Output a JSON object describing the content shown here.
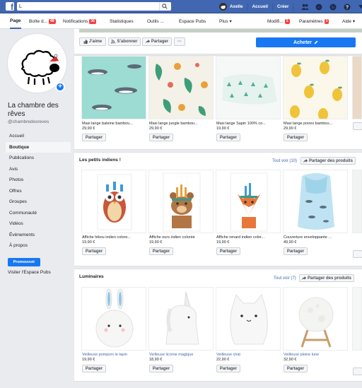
{
  "topbar": {
    "search_value": "L",
    "user_name": "Axelle",
    "home": "Accueil",
    "create": "Créer"
  },
  "pagenav": {
    "tabs": [
      {
        "label": "Page",
        "badge": ""
      },
      {
        "label": "Boîte d...",
        "badge": "48"
      },
      {
        "label": "Notifications",
        "badge": "36"
      },
      {
        "label": "Statistiques",
        "badge": ""
      },
      {
        "label": "Outils ...",
        "badge": ""
      },
      {
        "label": "Espace Pubs",
        "badge": ""
      },
      {
        "label": "Plus ▾",
        "badge": ""
      },
      {
        "label": "Modifi...",
        "badge": "3"
      },
      {
        "label": "Paramètres",
        "badge": "3"
      },
      {
        "label": "Aide ▾",
        "badge": ""
      }
    ]
  },
  "page": {
    "name": "La chambre des rêves",
    "handle": "@chambredesreves"
  },
  "left_nav": [
    "Accueil",
    "Boutique",
    "Publications",
    "Avis",
    "Photos",
    "Offres",
    "Groupes",
    "Communauté",
    "Vidéos",
    "Évènements",
    "À propos"
  ],
  "promote": "Promouvoir",
  "visit_ads": "Visiter l'Espace Pubs",
  "actions": {
    "like": "J'aime",
    "follow": "S'abonner",
    "share": "Partager",
    "more": "···",
    "buy": "Acheter"
  },
  "sections": [
    {
      "title": "",
      "see_all": "",
      "share_products": "",
      "products": [
        {
          "title": "Maxi lange baleine bambou...",
          "price": "29,90 €",
          "share": "Partager"
        },
        {
          "title": "Maxi lange jungle bambou...",
          "price": "29,90 €",
          "share": "Partager"
        },
        {
          "title": "Maxi lange Sapin 100% co...",
          "price": "19,90 €",
          "share": "Partager"
        },
        {
          "title": "Maxi lange poires bambou...",
          "price": "29,90 €",
          "share": "Partager"
        }
      ]
    },
    {
      "title": "Les petits indiens !",
      "see_all": "Tout voir (10)",
      "share_products": "Partager des produits",
      "products": [
        {
          "title": "Affiche hibou indien colore...",
          "price": "19,90 €",
          "share": "Partager"
        },
        {
          "title": "Affiche ours indien colorée",
          "price": "19,90 €",
          "share": "Partager"
        },
        {
          "title": "Affiche renard indien color...",
          "price": "19,90 €",
          "share": "Partager"
        },
        {
          "title": "Couverture enveloppante ...",
          "price": "49,90 €",
          "share": "Partager"
        }
      ]
    },
    {
      "title": "Luminaires",
      "see_all": "Tout voir (7)",
      "share_products": "Partager des produits",
      "products": [
        {
          "title": "Veilleuse pompom le lapin",
          "price": "19,90 €",
          "share": "Partager"
        },
        {
          "title": "Veilleuse licorne magique",
          "price": "18,90 €",
          "share": "Partager"
        },
        {
          "title": "Veilleuse chat",
          "price": "22,90 €",
          "share": "Partager"
        },
        {
          "title": "Veilleuse pleine lune",
          "price": "32,90 €",
          "share": "Partager"
        }
      ]
    }
  ]
}
